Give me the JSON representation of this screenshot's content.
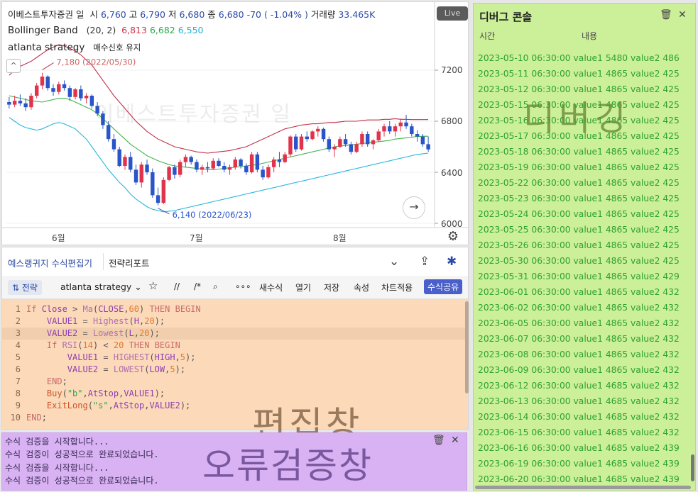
{
  "chart_panel": {
    "header": {
      "symbol": "이베스트투자증권 일",
      "open_label": "시",
      "open": "6,760",
      "high_label": "고",
      "high": "6,790",
      "low_label": "저",
      "low": "6,680",
      "close_label": "종",
      "close": "6,680",
      "change": "-70 ( -1.04% )",
      "volume_label": "거래량",
      "volume": "33.465K"
    },
    "bollinger": {
      "name": "Bollinger Band",
      "params": "(20, 2)",
      "upper": "6,813",
      "middle": "6,682",
      "lower": "6,550"
    },
    "strategy": {
      "name": "atlanta strategy",
      "signal": "매수신호 유지"
    },
    "live": "Live",
    "watermark": "이베스트투자증권 일",
    "max_annotation": "7,180 (2022/05/30)",
    "min_annotation": "6,140 (2022/06/23)",
    "price_ticks": [
      "7200",
      "6800",
      "6400",
      "6000"
    ],
    "months": [
      "6월",
      "7월",
      "8월"
    ]
  },
  "chart_data": {
    "type": "candlestick",
    "title": "이베스트투자증권 일",
    "ylim": [
      6000,
      7400
    ],
    "y_ticks": [
      6000,
      6400,
      6800,
      7200
    ],
    "x_ticks": [
      "6월",
      "7월",
      "8월"
    ],
    "candles": [
      [
        6950,
        6990,
        6900,
        6930
      ],
      [
        6930,
        7000,
        6910,
        6960
      ],
      [
        6960,
        7010,
        6920,
        6940
      ],
      [
        6940,
        6980,
        6880,
        6910
      ],
      [
        6910,
        7020,
        6890,
        7000
      ],
      [
        7000,
        7100,
        6980,
        7080
      ],
      [
        7080,
        7180,
        7050,
        7150
      ],
      [
        7150,
        7160,
        7040,
        7060
      ],
      [
        7060,
        7090,
        7000,
        7030
      ],
      [
        7030,
        7110,
        7010,
        7090
      ],
      [
        7090,
        7120,
        7040,
        7060
      ],
      [
        7060,
        7080,
        6960,
        6990
      ],
      [
        6990,
        7060,
        6970,
        7050
      ],
      [
        7050,
        7080,
        6960,
        6980
      ],
      [
        6980,
        7020,
        6940,
        7000
      ],
      [
        7000,
        7010,
        6900,
        6920
      ],
      [
        6920,
        6950,
        6840,
        6860
      ],
      [
        6860,
        6880,
        6740,
        6770
      ],
      [
        6770,
        6800,
        6640,
        6660
      ],
      [
        6660,
        6700,
        6560,
        6580
      ],
      [
        6580,
        6600,
        6440,
        6450
      ],
      [
        6450,
        6540,
        6420,
        6520
      ],
      [
        6520,
        6560,
        6400,
        6420
      ],
      [
        6420,
        6460,
        6300,
        6320
      ],
      [
        6320,
        6480,
        6280,
        6460
      ],
      [
        6460,
        6500,
        6380,
        6400
      ],
      [
        6400,
        6430,
        6200,
        6220
      ],
      [
        6220,
        6280,
        6140,
        6160
      ],
      [
        6160,
        6360,
        6150,
        6340
      ],
      [
        6340,
        6450,
        6330,
        6440
      ],
      [
        6440,
        6460,
        6350,
        6380
      ],
      [
        6380,
        6500,
        6360,
        6480
      ],
      [
        6480,
        6540,
        6440,
        6520
      ],
      [
        6520,
        6530,
        6460,
        6480
      ],
      [
        6480,
        6500,
        6400,
        6420
      ],
      [
        6420,
        6460,
        6380,
        6440
      ],
      [
        6440,
        6480,
        6400,
        6430
      ],
      [
        6430,
        6510,
        6420,
        6490
      ],
      [
        6490,
        6510,
        6440,
        6450
      ],
      [
        6450,
        6480,
        6400,
        6420
      ],
      [
        6420,
        6460,
        6380,
        6440
      ],
      [
        6440,
        6520,
        6420,
        6500
      ],
      [
        6500,
        6510,
        6430,
        6450
      ],
      [
        6450,
        6470,
        6380,
        6400
      ],
      [
        6400,
        6560,
        6390,
        6540
      ],
      [
        6540,
        6560,
        6400,
        6420
      ],
      [
        6420,
        6450,
        6340,
        6360
      ],
      [
        6360,
        6460,
        6350,
        6440
      ],
      [
        6440,
        6520,
        6400,
        6500
      ],
      [
        6500,
        6560,
        6440,
        6480
      ],
      [
        6480,
        6560,
        6470,
        6540
      ],
      [
        6540,
        6690,
        6520,
        6680
      ],
      [
        6680,
        6700,
        6560,
        6580
      ],
      [
        6580,
        6700,
        6570,
        6680
      ],
      [
        6680,
        6720,
        6640,
        6660
      ],
      [
        6660,
        6730,
        6650,
        6720
      ],
      [
        6720,
        6760,
        6680,
        6740
      ],
      [
        6740,
        6750,
        6640,
        6660
      ],
      [
        6660,
        6680,
        6560,
        6580
      ],
      [
        6580,
        6620,
        6520,
        6600
      ],
      [
        6600,
        6680,
        6590,
        6660
      ],
      [
        6660,
        6700,
        6600,
        6620
      ],
      [
        6620,
        6640,
        6540,
        6560
      ],
      [
        6560,
        6640,
        6550,
        6620
      ],
      [
        6620,
        6720,
        6600,
        6700
      ],
      [
        6700,
        6720,
        6600,
        6620
      ],
      [
        6620,
        6660,
        6580,
        6650
      ],
      [
        6650,
        6740,
        6640,
        6720
      ],
      [
        6720,
        6780,
        6680,
        6760
      ],
      [
        6760,
        6800,
        6700,
        6720
      ],
      [
        6720,
        6780,
        6680,
        6760
      ],
      [
        6760,
        6820,
        6720,
        6790
      ],
      [
        6790,
        6850,
        6740,
        6760
      ],
      [
        6760,
        6780,
        6680,
        6700
      ],
      [
        6700,
        6730,
        6640,
        6680
      ],
      [
        6680,
        6700,
        6600,
        6620
      ],
      [
        6620,
        6680,
        6560,
        6580
      ]
    ],
    "upper_band": [
      7160,
      7200,
      7230,
      7250,
      7270,
      7300,
      7330,
      7360,
      7380,
      7400,
      7390,
      7370,
      7350,
      7320,
      7280,
      7240,
      7180,
      7120,
      7060,
      7000,
      6950,
      6900,
      6850,
      6800,
      6760,
      6720,
      6690,
      6660,
      6640,
      6620,
      6600,
      6590,
      6580,
      6570,
      6560,
      6555,
      6550,
      6555,
      6560,
      6565,
      6570,
      6580,
      6590,
      6600,
      6620,
      6640,
      6660,
      6680,
      6700,
      6720,
      6740,
      6750,
      6760,
      6770,
      6775,
      6780,
      6780,
      6785,
      6790,
      6790,
      6795,
      6800,
      6800,
      6800,
      6805,
      6810,
      6810,
      6810,
      6815,
      6815,
      6820,
      6815,
      6815,
      6813,
      6813,
      6813,
      6813
    ],
    "middle_band": [
      7000,
      6990,
      6980,
      6970,
      6960,
      6955,
      6950,
      6960,
      6970,
      6980,
      6980,
      6970,
      6950,
      6930,
      6910,
      6890,
      6860,
      6820,
      6780,
      6740,
      6700,
      6660,
      6620,
      6590,
      6560,
      6530,
      6510,
      6490,
      6475,
      6460,
      6450,
      6445,
      6440,
      6435,
      6430,
      6425,
      6420,
      6420,
      6425,
      6430,
      6435,
      6440,
      6445,
      6450,
      6455,
      6460,
      6470,
      6480,
      6490,
      6500,
      6510,
      6520,
      6530,
      6540,
      6550,
      6560,
      6570,
      6580,
      6590,
      6600,
      6605,
      6610,
      6615,
      6620,
      6625,
      6630,
      6635,
      6640,
      6645,
      6650,
      6660,
      6665,
      6670,
      6675,
      6680,
      6682,
      6682
    ],
    "lower_band": [
      6830,
      6800,
      6770,
      6750,
      6740,
      6730,
      6740,
      6760,
      6780,
      6790,
      6780,
      6760,
      6740,
      6700,
      6660,
      6600,
      6540,
      6480,
      6420,
      6370,
      6320,
      6280,
      6230,
      6190,
      6160,
      6130,
      6110,
      6100,
      6090,
      6095,
      6100,
      6110,
      6120,
      6130,
      6140,
      6150,
      6160,
      6170,
      6180,
      6190,
      6200,
      6210,
      6220,
      6230,
      6240,
      6250,
      6260,
      6270,
      6280,
      6290,
      6300,
      6310,
      6320,
      6330,
      6340,
      6350,
      6360,
      6370,
      6380,
      6390,
      6400,
      6410,
      6420,
      6430,
      6440,
      6450,
      6460,
      6470,
      6480,
      6490,
      6500,
      6510,
      6520,
      6530,
      6540,
      6545,
      6550
    ]
  },
  "editor_panel": {
    "tabs": [
      "예스랭귀지 수식편집기",
      "전략리포트"
    ],
    "toolbar": {
      "strategy_toggle": "⇅ 전략",
      "strategy_name": "atlanta strategy ⌄",
      "tools": [
        "//",
        "/*",
        "∘∘∘",
        "새수식",
        "열기",
        "저장",
        "속성",
        "차트적용"
      ],
      "share": "수식공유"
    },
    "code_lines": [
      "If Close > Ma(CLOSE,60) THEN BEGIN",
      "    VALUE1 = Highest(H,20);",
      "    VALUE2 = Lowest(L,20);",
      "    If RSI(14) < 20 THEN BEGIN",
      "        VALUE1 = HIGHEST(HIGH,5);",
      "        VALUE2 = LOWEST(LOW,5);",
      "    END;",
      "    Buy(\"b\",AtStop,VALUE1);",
      "    ExitLong(\"s\",AtStop,VALUE2);",
      "END;"
    ],
    "overlay": "편집창"
  },
  "error_panel": {
    "lines": [
      "수식 검증을 시작합니다...",
      "수식 검증이 성공적으로 완료되었습니다.",
      "수식 검증을 시작합니다...",
      "수식 검증이 성공적으로 완료되었습니다."
    ],
    "overlay": "오류검증창"
  },
  "debug_panel": {
    "title": "디버그 콘솔",
    "col_time": "시간",
    "col_content": "내용",
    "overlay": "디버깅",
    "rows": [
      "2023-05-10 06:30:00 value1 5480 value2 486",
      "2023-05-11 06:30:00 value1 4865 value2 425",
      "2023-05-12 06:30:00 value1 4865 value2 425",
      "2023-05-15 06:30:00 value1 4865 value2 425",
      "2023-05-16 06:30:00 value1 4865 value2 425",
      "2023-05-17 06:30:00 value1 4865 value2 425",
      "2023-05-18 06:30:00 value1 4865 value2 425",
      "2023-05-19 06:30:00 value1 4865 value2 425",
      "2023-05-22 06:30:00 value1 4865 value2 425",
      "2023-05-23 06:30:00 value1 4865 value2 425",
      "2023-05-24 06:30:00 value1 4865 value2 425",
      "2023-05-25 06:30:00 value1 4865 value2 425",
      "2023-05-26 06:30:00 value1 4865 value2 425",
      "2023-05-30 06:30:00 value1 4865 value2 425",
      "2023-05-31 06:30:00 value1 4865 value2 429",
      "2023-06-01 06:30:00 value1 4865 value2 432",
      "2023-06-02 06:30:00 value1 4865 value2 432",
      "2023-06-05 06:30:00 value1 4865 value2 432",
      "2023-06-07 06:30:00 value1 4865 value2 432",
      "2023-06-08 06:30:00 value1 4865 value2 432",
      "2023-06-09 06:30:00 value1 4865 value2 432",
      "2023-06-12 06:30:00 value1 4685 value2 432",
      "2023-06-13 06:30:00 value1 4685 value2 432",
      "2023-06-14 06:30:00 value1 4685 value2 432",
      "2023-06-15 06:30:00 value1 4685 value2 432",
      "2023-06-16 06:30:00 value1 4685 value2 439",
      "2023-06-19 06:30:00 value1 4685 value2 439",
      "2023-06-20 06:30:00 value1 4685 value2 439"
    ]
  },
  "colors": {
    "up": "#e0334c",
    "down": "#2a55c9",
    "upper_band": "#c2304a",
    "middle_band": "#3fb34a",
    "lower_band": "#23b7de"
  }
}
